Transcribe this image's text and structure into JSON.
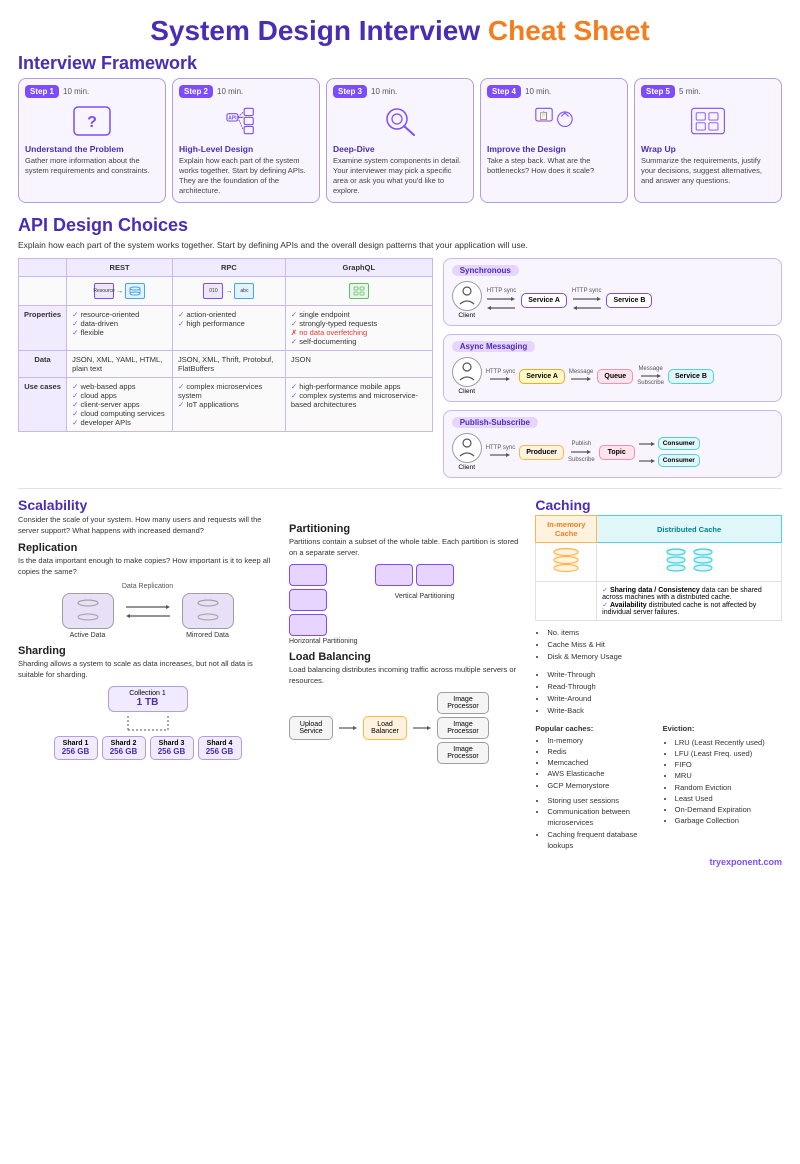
{
  "title": {
    "part1": "System Design Interview ",
    "part2": "Cheat Sheet"
  },
  "interview_framework": {
    "heading": "Interview Framework",
    "steps": [
      {
        "badge": "Step 1",
        "time": "10 min.",
        "icon": "question-mark",
        "title": "Understand the Problem",
        "desc": "Gather more information about the system requirements and constraints."
      },
      {
        "badge": "Step 2",
        "time": "10 min.",
        "icon": "api-design",
        "title": "High-Level Design",
        "desc": "Explain how each part of the system works together. Start by defining APIs. They are the foundation of the architecture."
      },
      {
        "badge": "Step 3",
        "time": "10 min.",
        "icon": "deep-dive",
        "title": "Deep-Dive",
        "desc": "Examine system components in detail. Your interviewer may pick a specific area or ask you what you'd like to explore."
      },
      {
        "badge": "Step 4",
        "time": "10 min.",
        "icon": "improve",
        "title": "Improve the Design",
        "desc": "Take a step back. What are the bottlenecks? How does it scale?"
      },
      {
        "badge": "Step 5",
        "time": "5 min.",
        "icon": "wrap-up",
        "title": "Wrap Up",
        "desc": "Summarize the requirements, justify your decisions, suggest alternatives, and answer any questions."
      }
    ]
  },
  "api_design": {
    "heading": "API Design Choices",
    "subtext": "Explain how each part of the system works together. Start by defining APIs and the overall design patterns that your application will use.",
    "table": {
      "headers": [
        "",
        "REST",
        "RPC",
        "GraphQL"
      ],
      "rows": [
        {
          "label": "Properties",
          "rest": [
            "resource-oriented",
            "data-driven",
            "flexible"
          ],
          "rpc": [
            "action-oriented",
            "high performance"
          ],
          "graphql": [
            "single endpoint",
            "strongly-typed requests",
            "no data overfetching",
            "self-documenting"
          ],
          "rest_checks": [
            true,
            true,
            true
          ],
          "rpc_checks": [
            true,
            true
          ],
          "graphql_checks": [
            true,
            true,
            false,
            true
          ]
        },
        {
          "label": "Data",
          "rest_data": "JSON, XML, YAML, HTML, plain text",
          "rpc_data": "JSON, XML, Thrift, Protobuf, FlatBuffers",
          "graphql_data": "JSON"
        },
        {
          "label": "Use cases",
          "rest": [
            "web-based apps",
            "cloud apps",
            "client-server apps",
            "cloud computing services",
            "developer APIs"
          ],
          "rpc": [
            "complex microservices system",
            "IoT applications"
          ],
          "graphql": [
            "high-performance mobile apps",
            "complex systems and microservice-based architectures"
          ],
          "rest_checks": [
            true,
            true,
            true,
            true,
            true
          ],
          "rpc_checks": [
            true,
            true
          ],
          "graphql_checks": [
            true,
            true
          ]
        }
      ]
    }
  },
  "comm_patterns": {
    "synchronous": {
      "label": "Synchronous",
      "client": "Client",
      "service_a": "Service A",
      "service_b": "Service B",
      "arrow1": "HTTP sync",
      "arrow2": "HTTP sync"
    },
    "async_messaging": {
      "label": "Async Messaging",
      "client": "Client",
      "service_a": "Service A",
      "queue": "Queue",
      "service_b": "Service B",
      "arrow1": "HTTP sync",
      "arrow2": "Message",
      "arrow3": "Message",
      "arrow4": "Subscribe"
    },
    "publish_subscribe": {
      "label": "Publish-Subscribe",
      "client": "Client",
      "producer": "Producer",
      "topic": "Topic",
      "consumer1": "Consumer",
      "consumer2": "Consumer",
      "arrow1": "HTTP sync",
      "arrow2": "Publish",
      "arrow3": "Subscribe",
      "arrow4": "Subscribe"
    }
  },
  "scalability": {
    "heading": "Scalability",
    "subtext": "Consider the scale of your system. How many users and requests will the server support? What happens with increased demand?",
    "replication": {
      "heading": "Replication",
      "desc": "Is the data important enough to make copies? How important is it to keep all copies the same?",
      "arrow_label": "Data Replication",
      "active_label": "Active Data",
      "mirrored_label": "Mirrored Data"
    },
    "sharding": {
      "heading": "Sharding",
      "desc": "Sharding allows a system to scale as data increases, but not all data is suitable for sharding.",
      "collection": "Collection 1",
      "collection_size": "1 TB",
      "shards": [
        {
          "label": "Shard 1",
          "size": "256 GB"
        },
        {
          "label": "Shard 2",
          "size": "256 GB"
        },
        {
          "label": "Shard 3",
          "size": "256 GB"
        },
        {
          "label": "Shard 4",
          "size": "256 GB"
        }
      ]
    },
    "partitioning": {
      "heading": "Partitioning",
      "desc": "Partitions contain a subset of the whole table. Each partition is stored on a separate server.",
      "horiz_label": "Horizontal Partitioning",
      "vert_label": "Vertical Partitioning"
    },
    "load_balancing": {
      "heading": "Load Balancing",
      "desc": "Load balancing distributes incoming traffic across multiple servers or resources.",
      "upload": "Upload Service",
      "balancer": "Load Balancer",
      "processors": [
        "Image Processor",
        "Image Processor",
        "Image Processor"
      ]
    }
  },
  "caching": {
    "heading": "Caching",
    "in_memory_label": "In-memory Cache",
    "distributed_label": "Distributed Cache",
    "sharing_title": "Sharing data / Consistency",
    "sharing_desc": "data can be shared across machines with a distributed cache.",
    "availability_title": "Availability",
    "availability_desc": "distributed cache is not affected by individual server failures.",
    "metrics": [
      "No. items",
      "Cache Miss & Hit",
      "Disk & Memory Usage"
    ],
    "strategies": [
      "Write-Through",
      "Read-Through",
      "Write-Around",
      "Write-Back"
    ],
    "popular_caches": {
      "title": "Popular caches:",
      "items": [
        "In-memory",
        "Redis",
        "Memcached",
        "AWS Elasticache",
        "GCP Memorystore"
      ]
    },
    "eviction": {
      "title": "Eviction:",
      "items": [
        "LRU (Least Recently used)",
        "LFU (Least Freq. used)",
        "FIFO",
        "MRU",
        "Random Eviction",
        "Least Used",
        "On-Demand Expiration",
        "Garbage Collection"
      ]
    },
    "use_cases": [
      "Storing user sessions",
      "Communication between microservices",
      "Caching frequent database lookups"
    ]
  },
  "footer": {
    "url": "tryexponent.com"
  }
}
